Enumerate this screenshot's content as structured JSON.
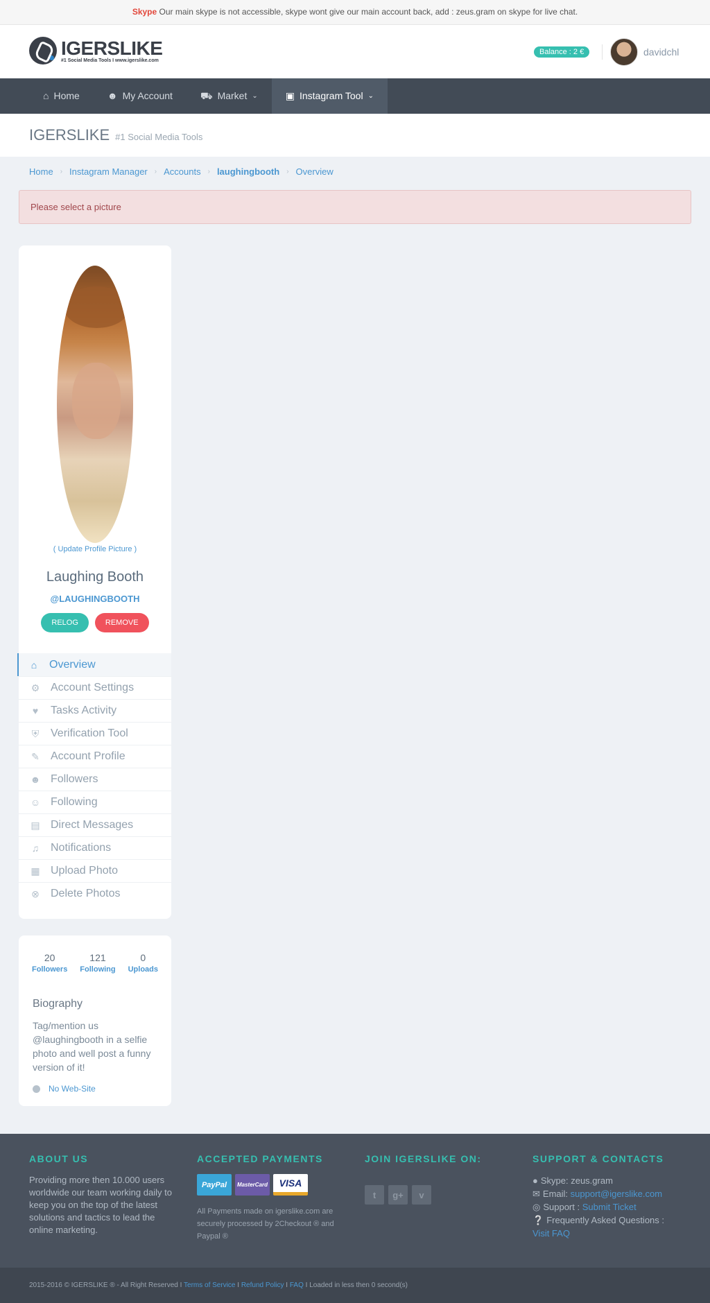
{
  "topbar": {
    "skype_label": "Skype",
    "message": "Our main skype is not accessible, skype wont give our main account back, add : zeus.gram on skype for live chat."
  },
  "header": {
    "logo_title": "IGERSLIKE",
    "logo_tagline": "#1 Social Media Tools I www.igerslike.com",
    "balance": "Balance : 2 €",
    "username": "davidchl"
  },
  "nav": {
    "items": [
      {
        "label": "Home",
        "icon": "home-icon"
      },
      {
        "label": "My Account",
        "icon": "user-icon"
      },
      {
        "label": "Market",
        "icon": "cart-icon"
      },
      {
        "label": "Instagram Tool",
        "icon": "instagram-icon"
      }
    ]
  },
  "page_head": {
    "title": "IGERSLIKE",
    "subtitle": "#1 Social Media Tools"
  },
  "breadcrumb": [
    "Home",
    "Instagram Manager",
    "Accounts",
    "laughingbooth",
    "Overview"
  ],
  "alert": "Please select a picture",
  "profile": {
    "update_picture": "( Update Profile Picture )",
    "name": "Laughing Booth",
    "handle": "@LAUGHINGBOOTH",
    "relog": "RELOG",
    "remove": "REMOVE"
  },
  "menu": [
    {
      "label": "Overview",
      "icon": "home-icon"
    },
    {
      "label": "Account Settings",
      "icon": "gear-icon"
    },
    {
      "label": "Tasks Activity",
      "icon": "heartbeat-icon"
    },
    {
      "label": "Verification Tool",
      "icon": "shield-icon"
    },
    {
      "label": "Account Profile",
      "icon": "edit-icon"
    },
    {
      "label": "Followers",
      "icon": "user-plus-icon"
    },
    {
      "label": "Following",
      "icon": "users-icon"
    },
    {
      "label": "Direct Messages",
      "icon": "inbox-icon"
    },
    {
      "label": "Notifications",
      "icon": "bell-icon"
    },
    {
      "label": "Upload Photo",
      "icon": "picture-icon"
    },
    {
      "label": "Delete Photos",
      "icon": "close-circle-icon"
    }
  ],
  "stats": {
    "followers": {
      "value": "20",
      "label": "Followers"
    },
    "following": {
      "value": "121",
      "label": "Following"
    },
    "uploads": {
      "value": "0",
      "label": "Uploads"
    }
  },
  "bio": {
    "title": "Biography",
    "text": "Tag/mention us @laughingbooth in a selfie photo and well post a funny version of it!",
    "website": "No Web-Site"
  },
  "footer": {
    "about_title": "ABOUT US",
    "about_text": "Providing more then 10.000 users worldwide our team working daily to keep you on the top of the latest solutions and tactics to lead the online marketing.",
    "payments_title": "ACCEPTED PAYMENTS",
    "payments": [
      "PayPal",
      "MasterCard",
      "VISA"
    ],
    "payments_note": "All Payments made on igerslike.com are securely processed by 2Checkout ® and Paypal ®",
    "join_title": "JOIN IGERSLIKE ON:",
    "social": [
      "twitter-icon",
      "google-plus-icon",
      "vimeo-icon"
    ],
    "support_title": "SUPPORT & CONTACTS",
    "skype": "Skype: zeus.gram",
    "email_label": "Email:",
    "email": "support@igerslike.com",
    "support_label": "Support :",
    "support_link": "Submit Ticket",
    "faq_label": "Frequently Asked Questions :",
    "faq_link": "Visit FAQ"
  },
  "copyright": {
    "text": "2015-2016 © IGERSLIKE ® - All Right Reserved I",
    "terms": "Terms of Service",
    "refund": "Refund Policy",
    "faq": "FAQ",
    "loaded": "I Loaded in less then 0 second(s)"
  },
  "colors": {
    "accent": "#36bfb0",
    "link": "#4b97d1",
    "danger": "#f0525c",
    "navbar": "#424b56",
    "footer": "#4a525e"
  }
}
